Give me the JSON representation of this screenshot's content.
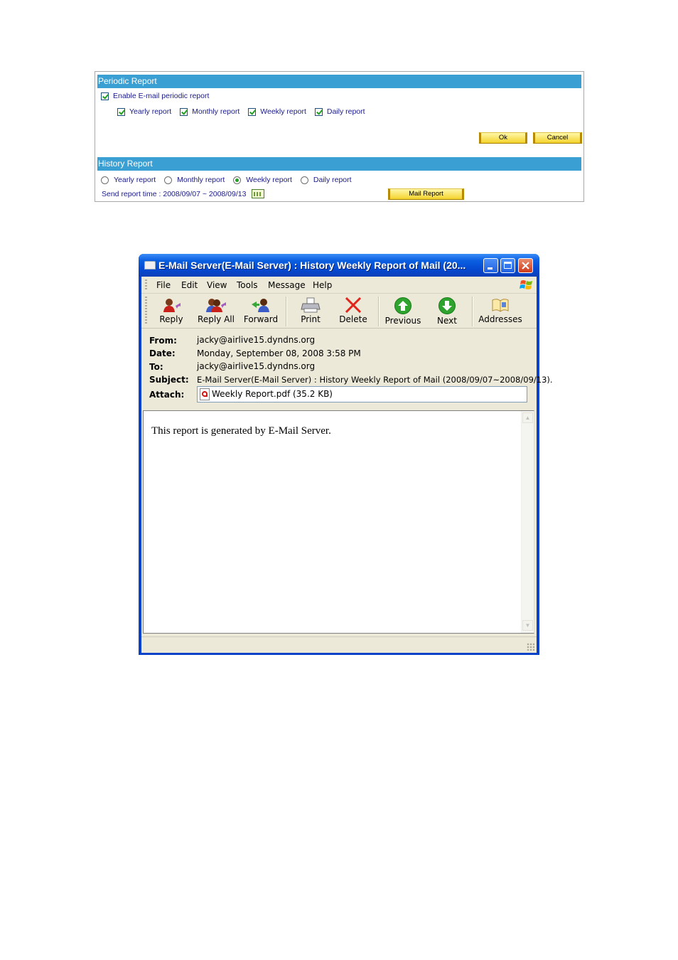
{
  "periodic": {
    "header": "Periodic Report",
    "enable_label": "Enable E-mail periodic report",
    "options": [
      "Yearly report",
      "Monthly report",
      "Weekly report",
      "Daily report"
    ],
    "ok_label": "Ok",
    "cancel_label": "Cancel"
  },
  "history": {
    "header": "History Report",
    "options": [
      "Yearly report",
      "Monthly report",
      "Weekly report",
      "Daily report"
    ],
    "selected": "Weekly report",
    "send_time_text": "Send report time : 2008/09/07 ~ 2008/09/13",
    "mail_button_label": "Mail Report"
  },
  "window": {
    "title": "E-Mail Server(E-Mail Server)  : History Weekly Report of Mail  (20...",
    "menu": [
      "File",
      "Edit",
      "View",
      "Tools",
      "Message",
      "Help"
    ],
    "toolbar": {
      "reply": "Reply",
      "reply_all": "Reply All",
      "forward": "Forward",
      "print": "Print",
      "delete": "Delete",
      "previous": "Previous",
      "next": "Next",
      "addresses": "Addresses"
    },
    "header_labels": {
      "from": "From:",
      "date": "Date:",
      "to": "To:",
      "subject": "Subject:",
      "attach": "Attach:"
    },
    "from": "jacky@airlive15.dyndns.org",
    "date": "Monday, September 08, 2008 3:58 PM",
    "to": "jacky@airlive15.dyndns.org",
    "subject": "E-Mail Server(E-Mail Server)  : History Weekly Report of Mail  (2008/09/07~2008/09/13).",
    "attachment": "Weekly Report.pdf (35.2 KB)",
    "body": "This report is generated by E-Mail Server."
  }
}
